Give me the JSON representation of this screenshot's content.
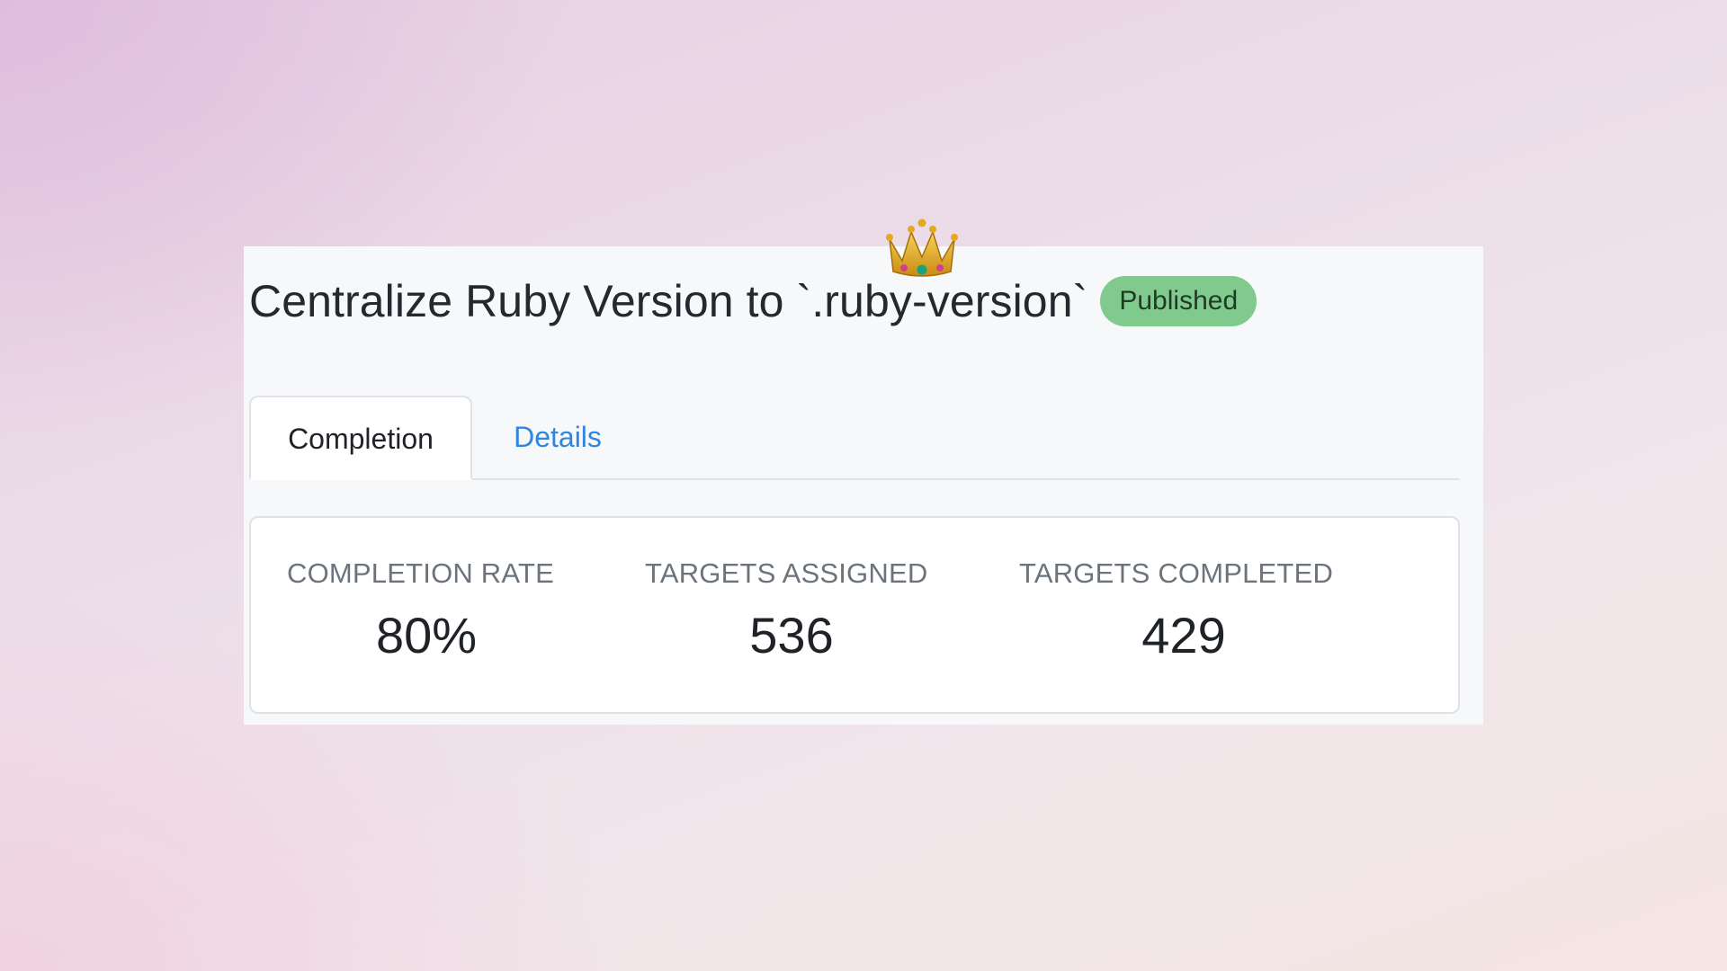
{
  "header": {
    "title": "Centralize Ruby Version to `.ruby-version`",
    "status_badge": "Published",
    "status_color": "#7fca8c",
    "decoration_icon": "crown-emoji"
  },
  "tabs": [
    {
      "label": "Completion",
      "active": true
    },
    {
      "label": "Details",
      "active": false
    }
  ],
  "stats": [
    {
      "label": "COMPLETION RATE",
      "value": "80%"
    },
    {
      "label": "TARGETS ASSIGNED",
      "value": "536"
    },
    {
      "label": "TARGETS COMPLETED",
      "value": "429"
    }
  ],
  "colors": {
    "link": "#2f86de",
    "text": "#1f2328",
    "muted": "#6b737d"
  }
}
